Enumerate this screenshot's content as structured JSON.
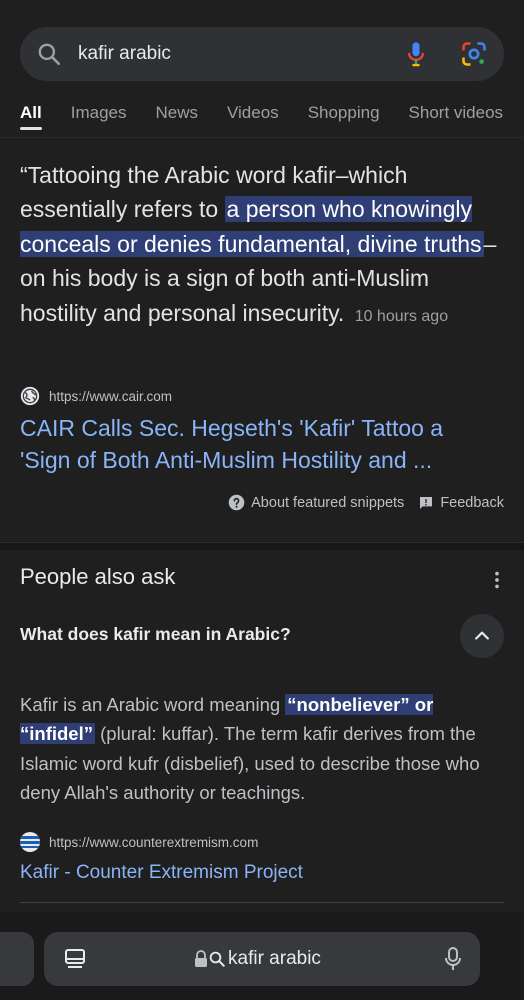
{
  "search": {
    "query": "kafir arabic"
  },
  "tabs": [
    {
      "label": "All",
      "active": true
    },
    {
      "label": "Images"
    },
    {
      "label": "News"
    },
    {
      "label": "Videos"
    },
    {
      "label": "Shopping"
    },
    {
      "label": "Short videos"
    }
  ],
  "featured_snippet": {
    "text_before": "“Tattooing the Arabic word kafir–which essentially refers to ",
    "highlight": "a person who knowingly conceals or denies fundamental, divine truths",
    "text_after": "–on his body is a sign of both anti-Muslim hostility and personal insecurity.",
    "time": "10 hours ago",
    "source_url": "https://www.cair.com",
    "title": "CAIR Calls Sec. Hegseth's 'Kafir' Tattoo a 'Sign of Both Anti-Muslim Hostility and ...",
    "about_label": "About featured snippets",
    "feedback_label": "Feedback"
  },
  "people_also_ask": {
    "heading": "People also ask",
    "question": "What does kafir mean in Arabic?",
    "answer_before": "Kafir is an Arabic word meaning ",
    "answer_highlight": "“nonbeliever” or “infidel”",
    "answer_after": " (plural: kuffar). The term kafir derives from the Islamic word kufr (disbelief), used to describe those who deny Allah's authority or teachings.",
    "source_url": "https://www.counterextremism.com",
    "link_title": "Kafir - Counter Extremism Project"
  },
  "bottom_bar": {
    "address_text": "kafir arabic"
  },
  "colors": {
    "background": "#1f1f1f",
    "link": "#8ab4f8",
    "highlight": "#2f3f76"
  },
  "icons": [
    "search-icon",
    "mic-icon",
    "lens-icon",
    "globe-icon",
    "help-circle-icon",
    "feedback-icon",
    "more-vert-icon",
    "chevron-up-icon",
    "flag-icon",
    "tabs-icon",
    "lock-icon",
    "search-small-icon",
    "mic-small-icon"
  ]
}
